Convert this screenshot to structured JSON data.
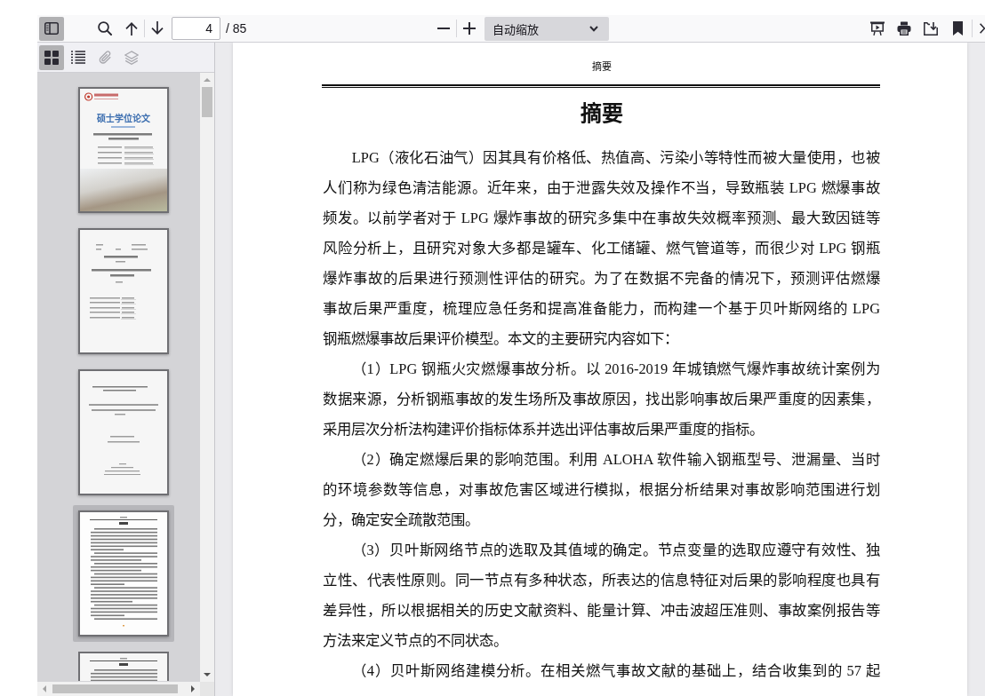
{
  "toolbar": {
    "sidebar_toggle": {
      "toggled": true
    },
    "page_input": {
      "value": "4"
    },
    "page_count": "/ 85",
    "zoom_select": {
      "value": "自动缩放"
    }
  },
  "sidebar": {
    "views": [
      {
        "kind": "thumbnails",
        "selected": true,
        "disabled": false
      },
      {
        "kind": "outline",
        "selected": false,
        "disabled": false
      },
      {
        "kind": "attachments",
        "selected": false,
        "disabled": true
      },
      {
        "kind": "layers",
        "selected": false,
        "disabled": true
      }
    ],
    "thumbnails": [
      {
        "kind": "cover",
        "title": "硕士学位论文",
        "selected": false
      },
      {
        "kind": "title_page",
        "selected": false
      },
      {
        "kind": "english_title_page",
        "selected": false
      },
      {
        "kind": "text_page",
        "selected": true
      },
      {
        "kind": "text_page",
        "selected": false
      }
    ]
  },
  "document": {
    "running_header": "摘要",
    "title": "摘要",
    "paragraphs": [
      {
        "lines": [
          "LPG（液化石油气）因其具有价格低、热值高、污染小等特性而被大量使用，也被",
          "人们称为绿色清洁能源。近年来，由于泄露失效及操作不当，导致瓶装 LPG 燃爆事故",
          "频发。以前学者对于 LPG 爆炸事故的研究多集中在事故失效概率预测、最大致因链等",
          "风险分析上，且研究对象大多都是罐车、化工储罐、燃气管道等，而很少对 LPG 钢瓶",
          "爆炸事故的后果进行预测性评估的研究。为了在数据不完备的情况下，预测评估燃爆",
          "事故后果严重度，梳理应急任务和提高准备能力，而构建一个基于贝叶斯网络的 LPG",
          "钢瓶燃爆事故后果评价模型。本文的主要研究内容如下："
        ]
      },
      {
        "lines": [
          "（1）LPG 钢瓶火灾燃爆事故分析。以 2016-2019 年城镇燃气爆炸事故统计案例为",
          "数据来源，分析钢瓶事故的发生场所及事故原因，找出影响事故后果严重度的因素集，",
          "采用层次分析法构建评价指标体系并选出评估事故后果严重度的指标。"
        ]
      },
      {
        "lines": [
          "（2）确定燃爆后果的影响范围。利用 ALOHA 软件输入钢瓶型号、泄漏量、当时",
          "的环境参数等信息，对事故危害区域进行模拟，根据分析结果对事故影响范围进行划",
          "分，确定安全疏散范围。"
        ]
      },
      {
        "lines": [
          "（3）贝叶斯网络节点的选取及其值域的确定。节点变量的选取应遵守有效性、独",
          "立性、代表性原则。同一节点有多种状态，所表达的信息特征对后果的影响程度也具有",
          "差异性，所以根据相关的历史文献资料、能量计算、冲击波超压准则、事故案例报告等",
          "方法来定义节点的不同状态。"
        ]
      },
      {
        "lines": [
          "（4）贝叶斯网络建模分析。在相关燃气事故文献的基础上，结合收集到的 57 起"
        ]
      }
    ]
  }
}
